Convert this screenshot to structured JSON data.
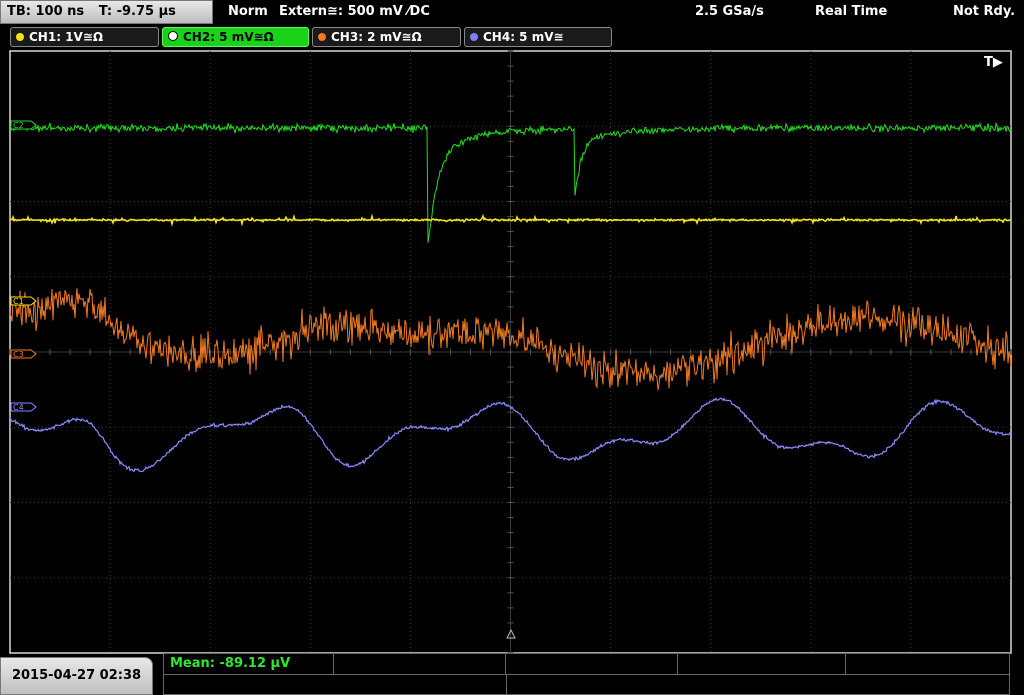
{
  "top_bar": {
    "timebase": "TB: 100 ns",
    "trigger_time": "T: -9.75 µs",
    "trigger_mode": "Norm",
    "trigger_source": "Extern≅: 500 mV ⁄DC",
    "sample_rate": "2.5 GSa/s",
    "acq_mode": "Real Time",
    "status": "Not Rdy."
  },
  "channels": [
    {
      "id": "ch1",
      "label": "CH1: 1V≅Ω",
      "color": "#f2e21a",
      "active": false
    },
    {
      "id": "ch2",
      "label": "CH2: 5 mV≅Ω",
      "color": "#22dd22",
      "active": true
    },
    {
      "id": "ch3",
      "label": "CH3: 2 mV≅Ω",
      "color": "#f07a1e",
      "active": false
    },
    {
      "id": "ch4",
      "label": "CH4: 5 mV≅",
      "color": "#8080ff",
      "active": false
    }
  ],
  "markers": {
    "trigger": "T▶",
    "ch2": "C2",
    "ch1": "C1",
    "ch3": "C3",
    "ch4": "C4"
  },
  "colors": {
    "ch1": "#f2e21a",
    "ch2": "#22dd22",
    "ch3": "#f07a1e",
    "ch4": "#8a8aff",
    "grid": "#3a3a3a",
    "frame": "#d8d8d8"
  },
  "bottom": {
    "datetime": "2015-04-27 02:38",
    "measurement": "Mean: -89.12 µV"
  }
}
